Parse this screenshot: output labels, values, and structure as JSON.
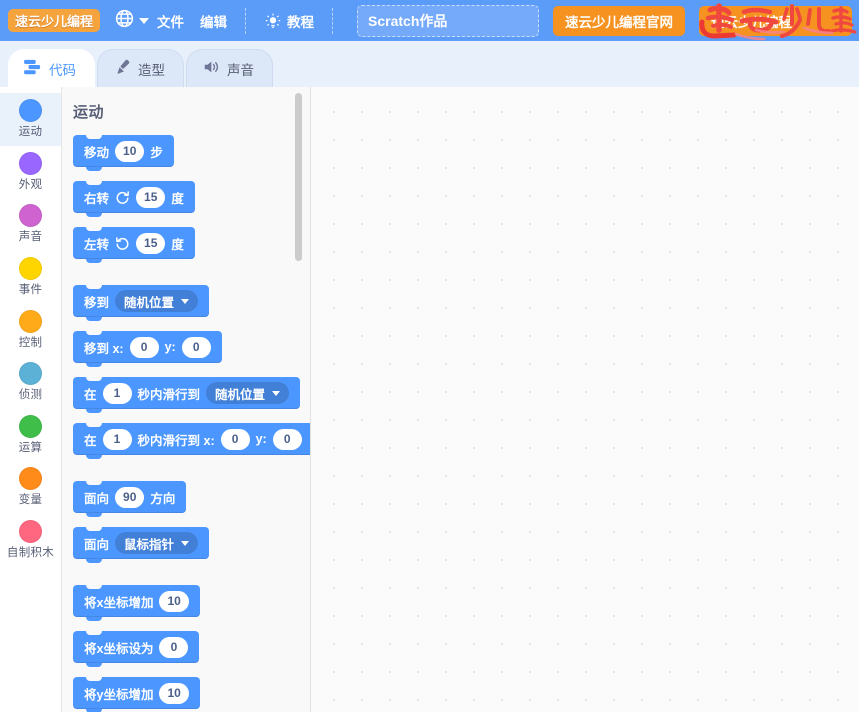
{
  "menubar": {
    "logo_text": "速云少儿编程",
    "language_icon": "globe-icon",
    "language_chevron": "chevron-down-icon",
    "file_label": "文件",
    "edit_label": "编辑",
    "tutorial_icon": "lightbulb-icon",
    "tutorial_label": "教程",
    "project_name_value": "Scratch作品",
    "project_name_placeholder": "Scratch作品",
    "official_site_button": "速云少儿编程官网",
    "second_button": "速云少儿编程",
    "decoration": "calligraphy-logo",
    "bar_color": "#5b9cf8",
    "accent_orange": "#f59220",
    "logo_orange": "#f5a33c"
  },
  "tabs": [
    {
      "label": "代码",
      "icon": "code-blocks-icon",
      "active": true
    },
    {
      "label": "造型",
      "icon": "paintbrush-icon",
      "active": false
    },
    {
      "label": "声音",
      "icon": "speaker-icon",
      "active": false
    }
  ],
  "categories": [
    {
      "label": "运动",
      "color": "#4c97ff",
      "selected": true
    },
    {
      "label": "外观",
      "color": "#9966ff",
      "selected": false
    },
    {
      "label": "声音",
      "color": "#cf63cf",
      "selected": false
    },
    {
      "label": "事件",
      "color": "#ffd500",
      "selected": false
    },
    {
      "label": "控制",
      "color": "#ffab19",
      "selected": false
    },
    {
      "label": "侦测",
      "color": "#5cb1d6",
      "selected": false
    },
    {
      "label": "运算",
      "color": "#3fbf4a",
      "selected": false
    },
    {
      "label": "变量",
      "color": "#ff8c1a",
      "selected": false
    },
    {
      "label": "自制积木",
      "color": "#ff6680",
      "selected": false
    }
  ],
  "palette": {
    "heading": "运动",
    "block_color": "#4c97ff",
    "dropdown_color": "#4280d7",
    "blocks": [
      {
        "id": "move-steps",
        "pre": "移动",
        "value": "10",
        "post": "步"
      },
      {
        "id": "turn-right",
        "pre": "右转",
        "icon": "turn-right-icon",
        "value": "15",
        "post": "度"
      },
      {
        "id": "turn-left",
        "pre": "左转",
        "icon": "turn-left-icon",
        "value": "15",
        "post": "度"
      },
      {
        "id": "goto-target",
        "pre": "移到",
        "dropdown": "随机位置"
      },
      {
        "id": "goto-xy",
        "pre": "移到 x:",
        "value": "0",
        "mid": "y:",
        "value2": "0"
      },
      {
        "id": "glide-target",
        "pre": "在",
        "value": "1",
        "mid": "秒内滑行到",
        "dropdown": "随机位置"
      },
      {
        "id": "glide-xy",
        "pre": "在",
        "value": "1",
        "mid": "秒内滑行到 x:",
        "value2": "0",
        "mid2": "y:",
        "value3": "0"
      },
      {
        "id": "point-direction",
        "pre": "面向",
        "value": "90",
        "post": "方向"
      },
      {
        "id": "point-towards",
        "pre": "面向",
        "dropdown": "鼠标指针"
      },
      {
        "id": "change-x-by",
        "pre": "将x坐标增加",
        "value": "10"
      },
      {
        "id": "set-x-to",
        "pre": "将x坐标设为",
        "value": "0"
      },
      {
        "id": "change-y-by",
        "pre": "将y坐标增加",
        "value": "10"
      }
    ],
    "scrollbar": {
      "visible": true
    }
  },
  "workspace": {
    "grid": "dotted",
    "background": "#fbfbfb"
  }
}
